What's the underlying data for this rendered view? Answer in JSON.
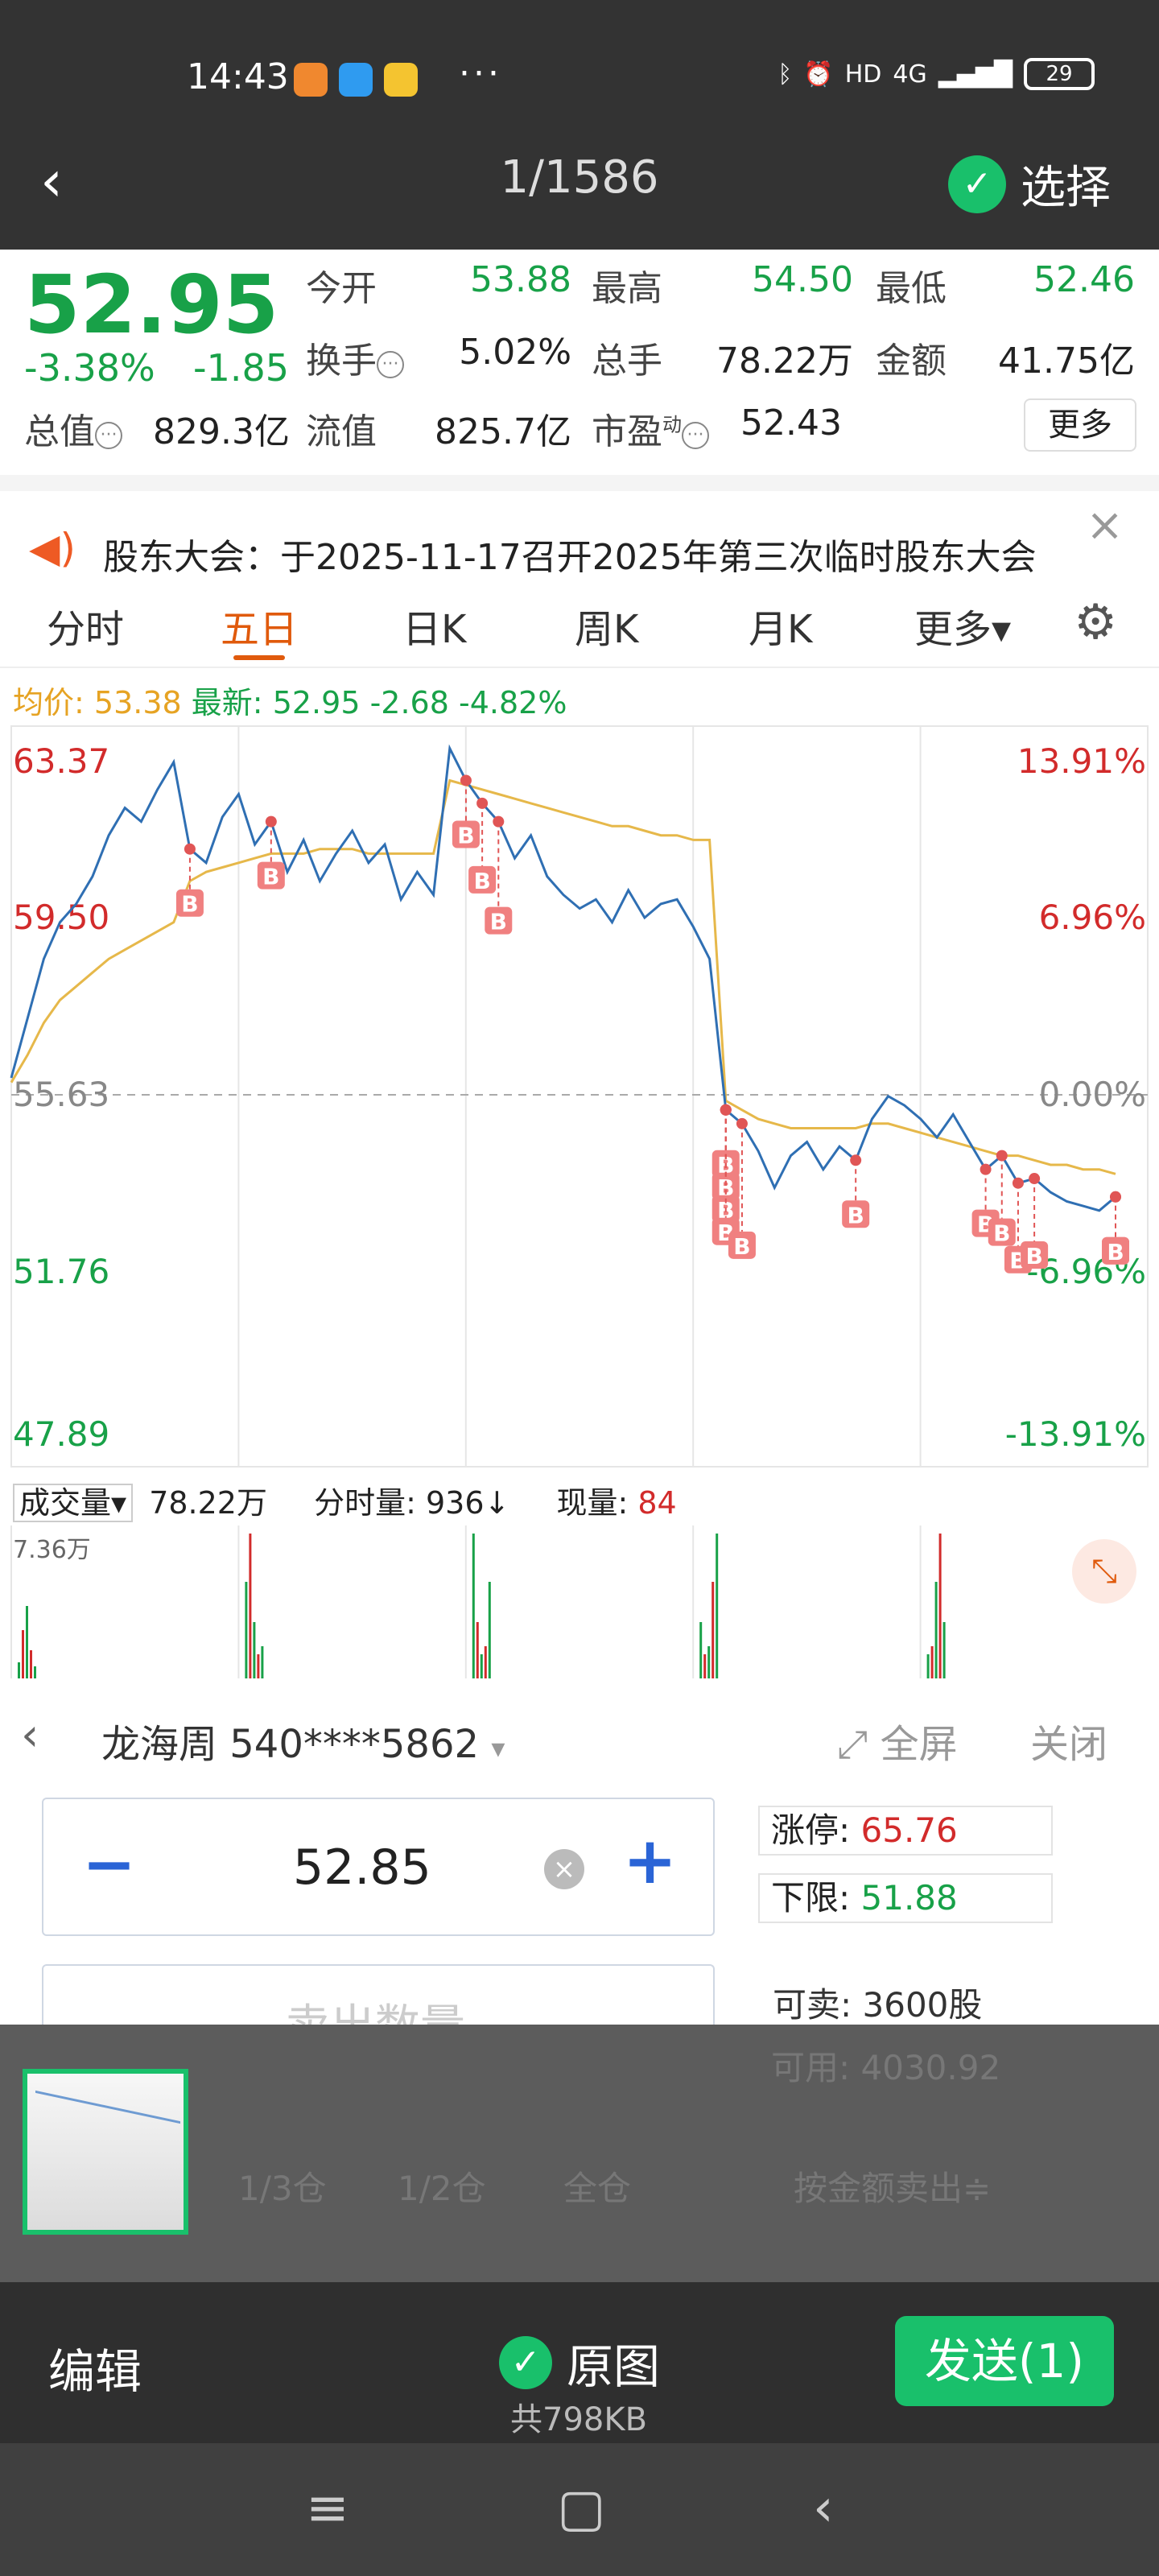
{
  "status_bar": {
    "time": "14:43",
    "dots": "···",
    "network": "4G",
    "hd": "HD",
    "battery": "29"
  },
  "top_bar": {
    "page_counter": "1/1586",
    "select_label": "选择"
  },
  "quote": {
    "price": "52.95",
    "change_pct": "-3.38%",
    "change": "-1.85",
    "open_label": "今开",
    "open": "53.88",
    "high_label": "最高",
    "high": "54.50",
    "low_label": "最低",
    "low": "52.46",
    "turnover_label": "换手",
    "turnover": "5.02%",
    "volume_label": "总手",
    "volume": "78.22万",
    "amount_label": "金额",
    "amount": "41.75亿",
    "mktcap_label": "总值",
    "mktcap": "829.3亿",
    "float_label": "流值",
    "float": "825.7亿",
    "pe_label": "市盈",
    "pe_sup": "动",
    "pe": "52.43",
    "more_label": "更多"
  },
  "announcement": {
    "text": "股东大会：于2025-11-17召开2025年第三次临时股东大会"
  },
  "tabs": [
    {
      "label": "分时"
    },
    {
      "label": "五日"
    },
    {
      "label": "日K"
    },
    {
      "label": "周K"
    },
    {
      "label": "月K"
    },
    {
      "label": "更多▾"
    }
  ],
  "avg_line": {
    "avg_label": "均价:",
    "avg": "53.38",
    "latest_label": "最新:",
    "latest": "52.95",
    "chg": "-2.68",
    "pct": "-4.82%"
  },
  "chart_data": {
    "type": "line",
    "title": "",
    "xlabel": "",
    "ylabel": "",
    "ylim": [
      47.89,
      63.37
    ],
    "y_ticks_left": [
      "63.37",
      "59.50",
      "55.63",
      "51.76",
      "47.89"
    ],
    "y_ticks_right": [
      "13.91%",
      "6.96%",
      "0.00%",
      "-6.96%",
      "-13.91%"
    ],
    "prev_close": 55.63,
    "days": 5,
    "series": [
      {
        "values": [
          56.0,
          57.3,
          58.6,
          59.4,
          59.8,
          60.4,
          61.3,
          61.9,
          61.6,
          62.3,
          62.9,
          61.0,
          60.7,
          61.7,
          62.2,
          61.1,
          61.6,
          60.5,
          61.2,
          60.3,
          60.9,
          61.4,
          60.7,
          61.1,
          59.9,
          60.5,
          60.0,
          63.2,
          62.5,
          62.0,
          61.6,
          60.8,
          61.3,
          60.4,
          60.0,
          59.7,
          59.9,
          59.4,
          60.1,
          59.5,
          59.8,
          59.9,
          59.3,
          58.6,
          55.3,
          55.0,
          54.4,
          53.6,
          54.3,
          54.6,
          54.0,
          54.5,
          54.2,
          55.1,
          55.6,
          55.4,
          55.1,
          54.7,
          55.2,
          54.6,
          54.0,
          54.3,
          53.7,
          53.8,
          53.5,
          53.3,
          53.2,
          53.1,
          53.4
        ]
      },
      {
        "values": [
          55.9,
          56.5,
          57.2,
          57.7,
          58.0,
          58.3,
          58.6,
          58.8,
          59.0,
          59.2,
          59.4,
          60.3,
          60.5,
          60.6,
          60.7,
          60.8,
          60.9,
          60.9,
          60.9,
          61.0,
          61.0,
          61.0,
          60.9,
          60.9,
          60.9,
          60.9,
          60.9,
          62.5,
          62.4,
          62.3,
          62.2,
          62.1,
          62.0,
          61.9,
          61.8,
          61.7,
          61.6,
          61.5,
          61.5,
          61.4,
          61.3,
          61.3,
          61.2,
          61.2,
          55.5,
          55.3,
          55.1,
          55.0,
          54.9,
          54.9,
          54.9,
          54.9,
          54.9,
          55.0,
          55.0,
          54.9,
          54.8,
          54.7,
          54.6,
          54.5,
          54.4,
          54.3,
          54.3,
          54.2,
          54.1,
          54.1,
          54.0,
          54.0,
          53.9
        ]
      }
    ],
    "markers": [
      "B",
      "B",
      "B",
      "B",
      "B",
      "B",
      "B",
      "B",
      "B",
      "B",
      "B",
      "B",
      "B",
      "B",
      "B",
      "B",
      "B"
    ]
  },
  "volume": {
    "label": "成交量",
    "total": "78.22万",
    "tick_label": "分时量:",
    "tick": "936↓",
    "now_label": "现量:",
    "now": "84",
    "ymax": "7.36万"
  },
  "trade": {
    "account": "龙海周 540****5862",
    "fullscreen": "全屏",
    "close": "关闭",
    "price": "52.85",
    "qty_placeholder": "卖出数量",
    "limit_up_label": "涨停:",
    "limit_up": "65.76",
    "limit_down_label": "下限:",
    "limit_down": "51.88",
    "sellable_label": "可卖:",
    "sellable": "3600股",
    "available_label": "可用:",
    "available": "4030.92",
    "pos_third": "1/3仓",
    "pos_half": "1/2仓",
    "pos_full": "全仓",
    "by_amount": "按金额卖出≑"
  },
  "bottom": {
    "edit": "编辑",
    "original": "原图",
    "size": "共798KB",
    "send": "发送(1)"
  },
  "colors": {
    "up": "#d22b2b",
    "down": "#18a148",
    "accent": "#e05a0c",
    "wechat_green": "#19c06b",
    "price_line": "#2f6fb3",
    "avg_line": "#e6b84a"
  }
}
